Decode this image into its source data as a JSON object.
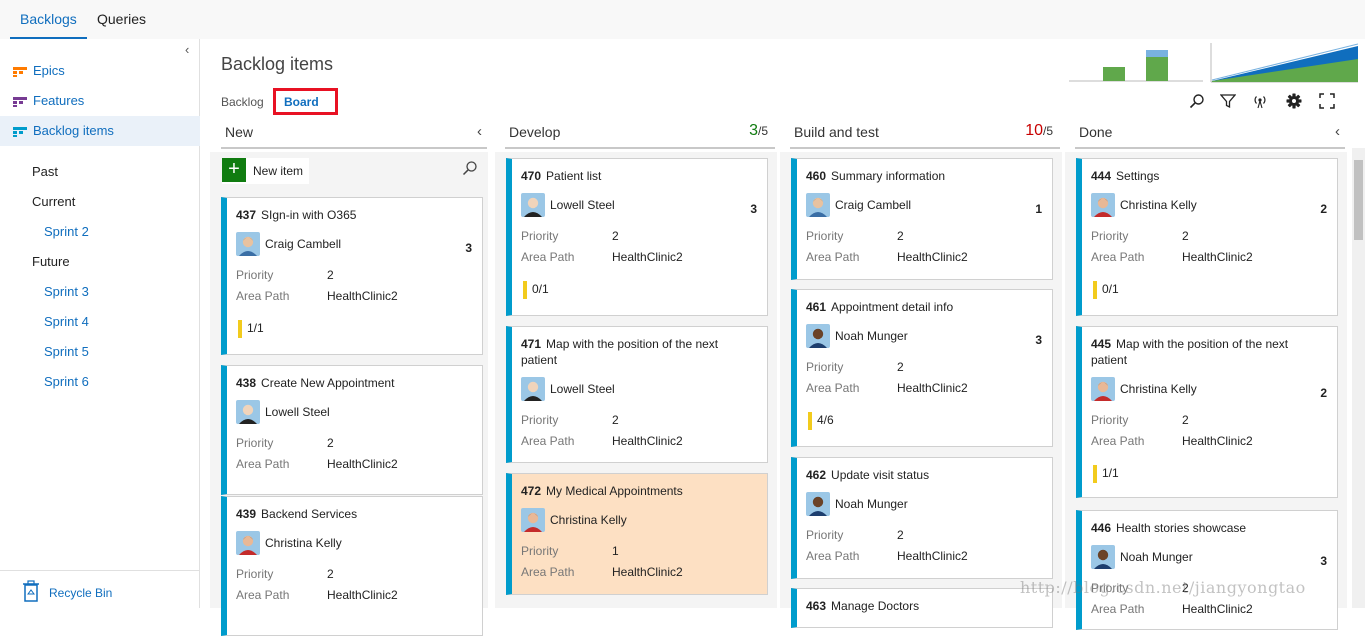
{
  "topnav": {
    "tabs": [
      {
        "label": "Backlogs"
      },
      {
        "label": "Queries"
      }
    ]
  },
  "sidebar": {
    "levels": [
      {
        "label": "Epics"
      },
      {
        "label": "Features"
      },
      {
        "label": "Backlog items"
      }
    ],
    "iterations": {
      "past": "Past",
      "current": "Current",
      "current_sprint": "Sprint 2",
      "future": "Future",
      "future_sprints": [
        "Sprint 3",
        "Sprint 4",
        "Sprint 5",
        "Sprint 6"
      ]
    },
    "recycle_bin": "Recycle Bin"
  },
  "header": {
    "title": "Backlog items",
    "pivot_backlog": "Backlog",
    "pivot_board": "Board"
  },
  "colors": {
    "accent": "#106ebe",
    "card_border": "#009ccc",
    "highlight_card": "#fde0c3",
    "over_limit": "#c80000",
    "under_limit": "#107c10"
  },
  "board": {
    "field_labels": {
      "priority": "Priority",
      "area": "Area Path"
    },
    "new_item_label": "New item",
    "columns": [
      {
        "name": "New",
        "cards": [
          {
            "id": "437",
            "title": "SIgn-in with O365",
            "person": "Craig Cambell",
            "effort": "3",
            "priority": "2",
            "area": "HealthClinic2",
            "tasks": "1/1"
          },
          {
            "id": "438",
            "title": "Create New Appointment",
            "person": "Lowell Steel",
            "effort": "",
            "priority": "2",
            "area": "HealthClinic2",
            "tasks": ""
          },
          {
            "id": "439",
            "title": "Backend Services",
            "person": "Christina Kelly",
            "effort": "",
            "priority": "2",
            "area": "HealthClinic2",
            "tasks": ""
          }
        ]
      },
      {
        "name": "Develop",
        "count": "3",
        "limit": "/5",
        "cards": [
          {
            "id": "470",
            "title": "Patient list",
            "person": "Lowell Steel",
            "effort": "3",
            "priority": "2",
            "area": "HealthClinic2",
            "tasks": "0/1"
          },
          {
            "id": "471",
            "title": "Map with the position of the next patient",
            "person": "Lowell Steel",
            "effort": "",
            "priority": "2",
            "area": "HealthClinic2",
            "tasks": ""
          },
          {
            "id": "472",
            "title": "My Medical Appointments",
            "person": "Christina Kelly",
            "effort": "",
            "priority": "1",
            "area": "HealthClinic2",
            "tasks": ""
          }
        ]
      },
      {
        "name": "Build and test",
        "count": "10",
        "limit": "/5",
        "cards": [
          {
            "id": "460",
            "title": "Summary information",
            "person": "Craig Cambell",
            "effort": "1",
            "priority": "2",
            "area": "HealthClinic2",
            "tasks": ""
          },
          {
            "id": "461",
            "title": "Appointment detail info",
            "person": "Noah Munger",
            "effort": "3",
            "priority": "2",
            "area": "HealthClinic2",
            "tasks": "4/6"
          },
          {
            "id": "462",
            "title": "Update visit status",
            "person": "Noah Munger",
            "effort": "",
            "priority": "2",
            "area": "HealthClinic2",
            "tasks": ""
          },
          {
            "id": "463",
            "title": "Manage Doctors"
          }
        ]
      },
      {
        "name": "Done",
        "cards": [
          {
            "id": "444",
            "title": "Settings",
            "person": "Christina Kelly",
            "effort": "2",
            "priority": "2",
            "area": "HealthClinic2",
            "tasks": "0/1"
          },
          {
            "id": "445",
            "title": "Map with the position of the next patient",
            "person": "Christina Kelly",
            "effort": "2",
            "priority": "2",
            "area": "HealthClinic2",
            "tasks": "1/1"
          },
          {
            "id": "446",
            "title": "Health stories showcase",
            "person": "Noah Munger",
            "effort": "3",
            "priority": "2",
            "area": "HealthClinic2",
            "tasks": ""
          }
        ]
      }
    ]
  },
  "watermark": "http://blog.csdn.net/jiangyongtao"
}
